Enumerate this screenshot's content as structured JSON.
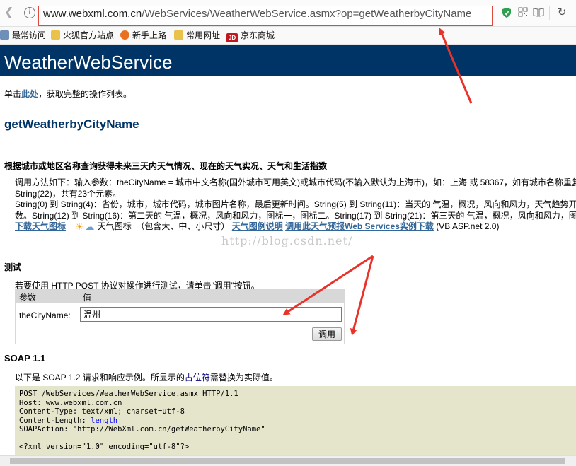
{
  "browser": {
    "url_host": "www.webxml.com.cn",
    "url_path": "/WebServices/WeatherWebService.asmx?op=getWeatherbyCityName",
    "icons": [
      "back-icon",
      "info-icon",
      "shield-icon",
      "qr-icon",
      "reader-icon",
      "refresh-icon"
    ],
    "bookmarks": [
      {
        "label": "最常访问",
        "icon": "gear-icon"
      },
      {
        "label": "火狐官方站点",
        "icon": "folder-icon"
      },
      {
        "label": "新手上路",
        "icon": "firefox-icon"
      },
      {
        "label": "常用网址",
        "icon": "folder-icon"
      },
      {
        "label": "京东商城",
        "icon": "jd-icon",
        "icon_text": "JD"
      }
    ]
  },
  "page": {
    "heading": "WeatherWebService",
    "intro_prefix": "单击",
    "intro_link": "此处",
    "intro_suffix": "，获取完整的操作列表。",
    "op_title": "getWeatherbyCityName",
    "op_desc": "根据城市或地区名称查询获得未来三天内天气情况、现在的天气实况、天气和生活指数",
    "desc_line1": "调用方法如下：输入参数：theCityName = 城市中文名称(国外城市可用英文)或城市代码(不输入默认为上海市)，如：上海 或 58367，如有城市名称重复请使",
    "desc_line2": "String(22)，共有23个元素。",
    "desc_line3": "String(0) 到 String(4)：省份，城市，城市代码，城市图片名称，最后更新时间。String(5) 到 String(11)：当天的 气温，概况，风向和风力，天气趋势开始图",
    "desc_line4": "数。String(12) 到 String(16)：第二天的 气温，概况，风向和风力，图标一，图标二。String(17) 到 String(21)：第三天的 气温，概况，风向和风力，图标",
    "link_icons": "下载天气图标",
    "weather_icon_label": "天气图标",
    "icon_sizes": "（包含大、中、小尺寸）",
    "link_legend": "天气图例说明",
    "link_example": "调用此天气预报Web Services实例下载",
    "vb_note": "(VB ASP.net 2.0)",
    "watermark": "http://blog.csdn.net/"
  },
  "test": {
    "title": "测试",
    "intro": "若要使用 HTTP POST 协议对操作进行测试，请单击“调用”按钮。",
    "col_param": "参数",
    "col_value": "值",
    "param_name": "theCityName:",
    "param_value": "温州",
    "invoke_label": "调用"
  },
  "soap": {
    "title": "SOAP 1.1",
    "intro_prefix": "以下是 SOAP 1.2 请求和响应示例。所显示的",
    "intro_placeholder": "占位符",
    "intro_suffix": "需替换为实际值。",
    "code_line1": "POST /WebServices/WeatherWebService.asmx HTTP/1.1",
    "code_line2": "Host: www.webxml.com.cn",
    "code_line3": "Content-Type: text/xml; charset=utf-8",
    "code_line4_key": "Content-Length: ",
    "code_line4_val": "length",
    "code_line5": "SOAPAction: \"http://WebXml.com.cn/getWeatherbyCityName\"",
    "code_line7": "<?xml version=\"1.0\" encoding=\"utf-8\"?>"
  },
  "colors": {
    "header_bg": "#003366",
    "link": "#336699",
    "code_bg": "#e5e5cc",
    "annotation_arrow": "#e8332a"
  }
}
